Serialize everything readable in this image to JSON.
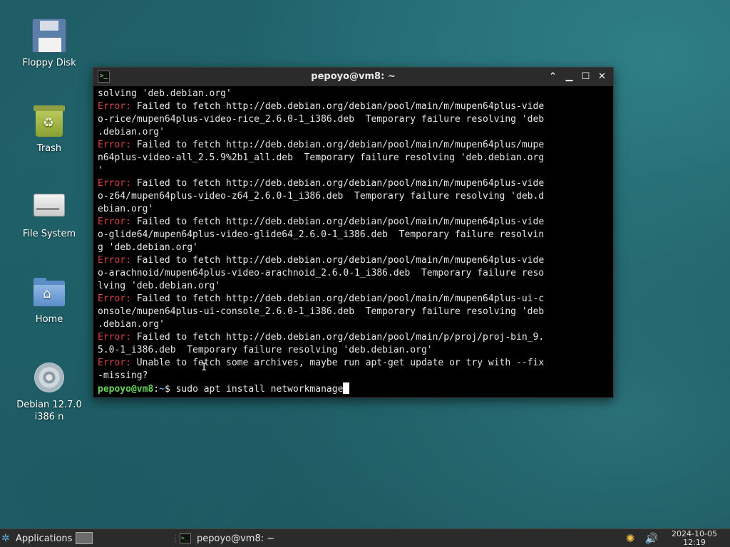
{
  "desktop": {
    "icons": [
      {
        "label": "Floppy Disk",
        "icon": "floppy-disk-icon"
      },
      {
        "label": "Trash",
        "icon": "trash-icon"
      },
      {
        "label": "File System",
        "icon": "file-system-icon"
      },
      {
        "label": "Home",
        "icon": "home-folder-icon"
      },
      {
        "label_line1": "Debian 12.7.0",
        "label_line2": "i386 n",
        "icon": "optical-disc-icon"
      }
    ]
  },
  "terminal": {
    "title": "pepoyo@vm8: ~",
    "lines": [
      {
        "text": "solving 'deb.debian.org'"
      },
      {
        "err": "Error:",
        "text": " Failed to fetch http://deb.debian.org/debian/pool/main/m/mupen64plus-vide"
      },
      {
        "text": "o-rice/mupen64plus-video-rice_2.6.0-1_i386.deb  Temporary failure resolving 'deb"
      },
      {
        "text": ".debian.org'"
      },
      {
        "err": "Error:",
        "text": " Failed to fetch http://deb.debian.org/debian/pool/main/m/mupen64plus/mupe"
      },
      {
        "text": "n64plus-video-all_2.5.9%2b1_all.deb  Temporary failure resolving 'deb.debian.org"
      },
      {
        "text": "'"
      },
      {
        "err": "Error:",
        "text": " Failed to fetch http://deb.debian.org/debian/pool/main/m/mupen64plus-vide"
      },
      {
        "text": "o-z64/mupen64plus-video-z64_2.6.0-1_i386.deb  Temporary failure resolving 'deb.d"
      },
      {
        "text": "ebian.org'"
      },
      {
        "err": "Error:",
        "text": " Failed to fetch http://deb.debian.org/debian/pool/main/m/mupen64plus-vide"
      },
      {
        "text": "o-glide64/mupen64plus-video-glide64_2.6.0-1_i386.deb  Temporary failure resolvin"
      },
      {
        "text": "g 'deb.debian.org'"
      },
      {
        "err": "Error:",
        "text": " Failed to fetch http://deb.debian.org/debian/pool/main/m/mupen64plus-vide"
      },
      {
        "text": "o-arachnoid/mupen64plus-video-arachnoid_2.6.0-1_i386.deb  Temporary failure reso"
      },
      {
        "text": "lving 'deb.debian.org'"
      },
      {
        "err": "Error:",
        "text": " Failed to fetch http://deb.debian.org/debian/pool/main/m/mupen64plus-ui-c"
      },
      {
        "text": "onsole/mupen64plus-ui-console_2.6.0-1_i386.deb  Temporary failure resolving 'deb"
      },
      {
        "text": ".debian.org'"
      },
      {
        "err": "Error:",
        "text": " Failed to fetch http://deb.debian.org/debian/pool/main/p/proj/proj-bin_9."
      },
      {
        "text": "5.0-1_i386.deb  Temporary failure resolving 'deb.debian.org'"
      },
      {
        "err": "Error:",
        "text": " Unable to fetch some archives, maybe run apt-get update or try with --fix"
      },
      {
        "text": "-missing?"
      }
    ],
    "prompt_user": "pepoyo@vm8",
    "prompt_sep": ":",
    "prompt_path": "~",
    "prompt_symbol": "$",
    "command": " sudo apt install networkmanage"
  },
  "taskbar": {
    "applications_label": "Applications",
    "task_label": "pepoyo@vm8: ~",
    "clock_date": "2024-10-05",
    "clock_time": "12:19"
  }
}
